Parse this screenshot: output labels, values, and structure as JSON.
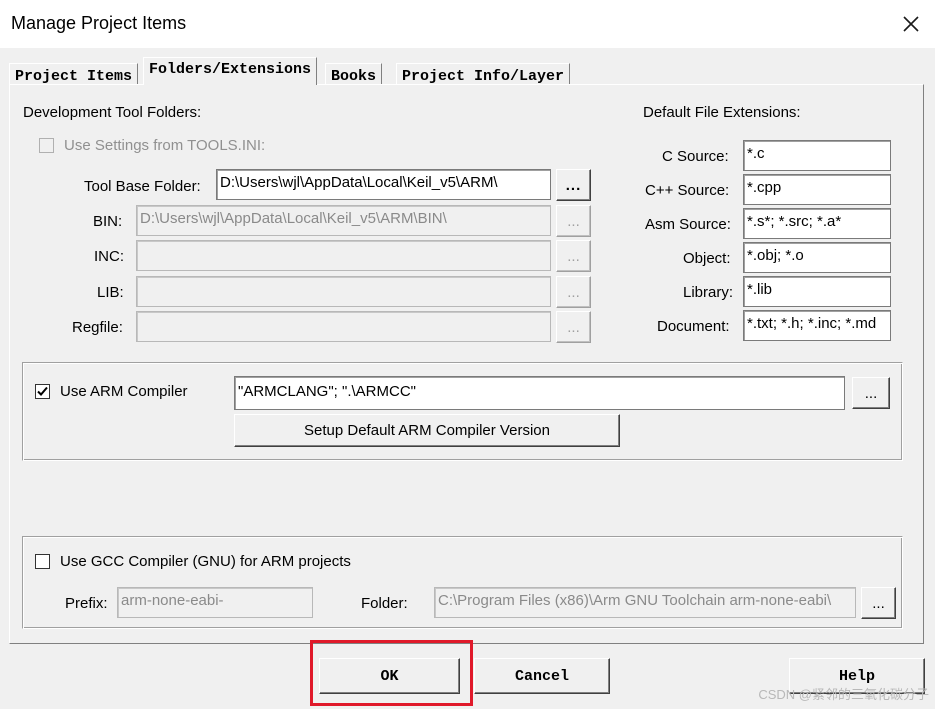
{
  "window": {
    "title": "Manage Project Items"
  },
  "tabs": [
    {
      "label": "Project Items",
      "active": false
    },
    {
      "label": "Folders/Extensions",
      "active": true
    },
    {
      "label": "Books",
      "active": false
    },
    {
      "label": "Project Info/Layer",
      "active": false
    }
  ],
  "dev_folders": {
    "heading": "Development Tool Folders:",
    "use_tools_ini": {
      "label": "Use Settings from TOOLS.INI:",
      "checked": false,
      "enabled": false
    },
    "tool_base": {
      "label": "Tool Base Folder:",
      "value": "D:\\Users\\wjl\\AppData\\Local\\Keil_v5\\ARM\\"
    },
    "bin": {
      "label": "BIN:",
      "value": "D:\\Users\\wjl\\AppData\\Local\\Keil_v5\\ARM\\BIN\\"
    },
    "inc": {
      "label": "INC:",
      "value": ""
    },
    "lib": {
      "label": "LIB:",
      "value": ""
    },
    "regfile": {
      "label": "Regfile:",
      "value": ""
    },
    "browse_label": "..."
  },
  "extensions": {
    "heading": "Default File Extensions:",
    "items": [
      {
        "label": "C Source:",
        "value": "*.c"
      },
      {
        "label": "C++ Source:",
        "value": "*.cpp"
      },
      {
        "label": "Asm Source:",
        "value": "*.s*; *.src; *.a*"
      },
      {
        "label": "Object:",
        "value": "*.obj; *.o"
      },
      {
        "label": "Library:",
        "value": "*.lib"
      },
      {
        "label": "Document:",
        "value": "*.txt; *.h; *.inc; *.md"
      }
    ]
  },
  "arm_compiler": {
    "label": "Use ARM Compiler",
    "checked": true,
    "value": "\"ARMCLANG\"; \".\\ARMCC\"",
    "setup_button": "Setup Default ARM Compiler Version",
    "browse_label": "..."
  },
  "gcc_compiler": {
    "label": "Use GCC Compiler (GNU) for ARM projects",
    "checked": false,
    "prefix_label": "Prefix:",
    "prefix_value": "arm-none-eabi-",
    "folder_label": "Folder:",
    "folder_value": "C:\\Program Files (x86)\\Arm GNU Toolchain arm-none-eabi\\",
    "browse_label": "..."
  },
  "buttons": {
    "ok": "OK",
    "cancel": "Cancel",
    "help": "Help"
  },
  "watermark": "CSDN @紧邻的三氧化碳分子",
  "colors": {
    "highlight_box": "#e0192a"
  }
}
